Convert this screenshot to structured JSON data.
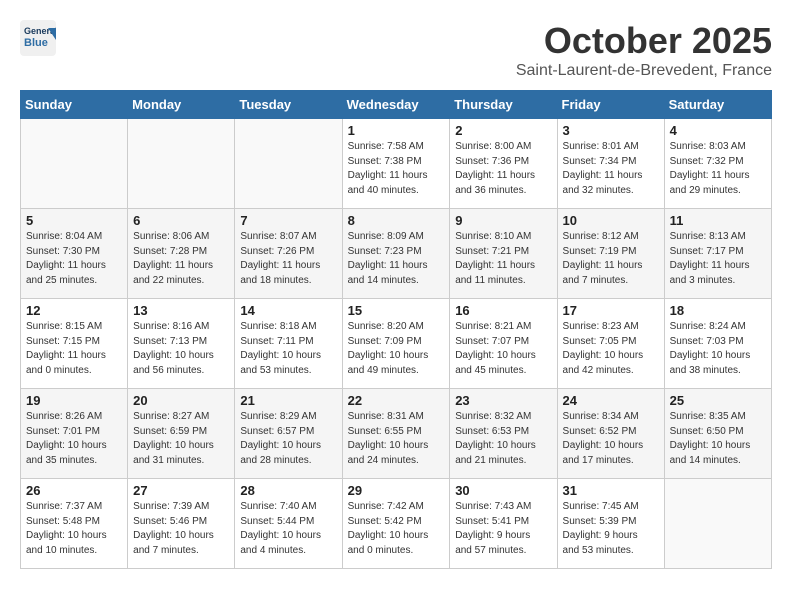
{
  "header": {
    "logo_line1": "General",
    "logo_line2": "Blue",
    "month": "October 2025",
    "location": "Saint-Laurent-de-Brevedent, France"
  },
  "weekdays": [
    "Sunday",
    "Monday",
    "Tuesday",
    "Wednesday",
    "Thursday",
    "Friday",
    "Saturday"
  ],
  "weeks": [
    [
      {
        "day": "",
        "info": ""
      },
      {
        "day": "",
        "info": ""
      },
      {
        "day": "",
        "info": ""
      },
      {
        "day": "1",
        "info": "Sunrise: 7:58 AM\nSunset: 7:38 PM\nDaylight: 11 hours\nand 40 minutes."
      },
      {
        "day": "2",
        "info": "Sunrise: 8:00 AM\nSunset: 7:36 PM\nDaylight: 11 hours\nand 36 minutes."
      },
      {
        "day": "3",
        "info": "Sunrise: 8:01 AM\nSunset: 7:34 PM\nDaylight: 11 hours\nand 32 minutes."
      },
      {
        "day": "4",
        "info": "Sunrise: 8:03 AM\nSunset: 7:32 PM\nDaylight: 11 hours\nand 29 minutes."
      }
    ],
    [
      {
        "day": "5",
        "info": "Sunrise: 8:04 AM\nSunset: 7:30 PM\nDaylight: 11 hours\nand 25 minutes."
      },
      {
        "day": "6",
        "info": "Sunrise: 8:06 AM\nSunset: 7:28 PM\nDaylight: 11 hours\nand 22 minutes."
      },
      {
        "day": "7",
        "info": "Sunrise: 8:07 AM\nSunset: 7:26 PM\nDaylight: 11 hours\nand 18 minutes."
      },
      {
        "day": "8",
        "info": "Sunrise: 8:09 AM\nSunset: 7:23 PM\nDaylight: 11 hours\nand 14 minutes."
      },
      {
        "day": "9",
        "info": "Sunrise: 8:10 AM\nSunset: 7:21 PM\nDaylight: 11 hours\nand 11 minutes."
      },
      {
        "day": "10",
        "info": "Sunrise: 8:12 AM\nSunset: 7:19 PM\nDaylight: 11 hours\nand 7 minutes."
      },
      {
        "day": "11",
        "info": "Sunrise: 8:13 AM\nSunset: 7:17 PM\nDaylight: 11 hours\nand 3 minutes."
      }
    ],
    [
      {
        "day": "12",
        "info": "Sunrise: 8:15 AM\nSunset: 7:15 PM\nDaylight: 11 hours\nand 0 minutes."
      },
      {
        "day": "13",
        "info": "Sunrise: 8:16 AM\nSunset: 7:13 PM\nDaylight: 10 hours\nand 56 minutes."
      },
      {
        "day": "14",
        "info": "Sunrise: 8:18 AM\nSunset: 7:11 PM\nDaylight: 10 hours\nand 53 minutes."
      },
      {
        "day": "15",
        "info": "Sunrise: 8:20 AM\nSunset: 7:09 PM\nDaylight: 10 hours\nand 49 minutes."
      },
      {
        "day": "16",
        "info": "Sunrise: 8:21 AM\nSunset: 7:07 PM\nDaylight: 10 hours\nand 45 minutes."
      },
      {
        "day": "17",
        "info": "Sunrise: 8:23 AM\nSunset: 7:05 PM\nDaylight: 10 hours\nand 42 minutes."
      },
      {
        "day": "18",
        "info": "Sunrise: 8:24 AM\nSunset: 7:03 PM\nDaylight: 10 hours\nand 38 minutes."
      }
    ],
    [
      {
        "day": "19",
        "info": "Sunrise: 8:26 AM\nSunset: 7:01 PM\nDaylight: 10 hours\nand 35 minutes."
      },
      {
        "day": "20",
        "info": "Sunrise: 8:27 AM\nSunset: 6:59 PM\nDaylight: 10 hours\nand 31 minutes."
      },
      {
        "day": "21",
        "info": "Sunrise: 8:29 AM\nSunset: 6:57 PM\nDaylight: 10 hours\nand 28 minutes."
      },
      {
        "day": "22",
        "info": "Sunrise: 8:31 AM\nSunset: 6:55 PM\nDaylight: 10 hours\nand 24 minutes."
      },
      {
        "day": "23",
        "info": "Sunrise: 8:32 AM\nSunset: 6:53 PM\nDaylight: 10 hours\nand 21 minutes."
      },
      {
        "day": "24",
        "info": "Sunrise: 8:34 AM\nSunset: 6:52 PM\nDaylight: 10 hours\nand 17 minutes."
      },
      {
        "day": "25",
        "info": "Sunrise: 8:35 AM\nSunset: 6:50 PM\nDaylight: 10 hours\nand 14 minutes."
      }
    ],
    [
      {
        "day": "26",
        "info": "Sunrise: 7:37 AM\nSunset: 5:48 PM\nDaylight: 10 hours\nand 10 minutes."
      },
      {
        "day": "27",
        "info": "Sunrise: 7:39 AM\nSunset: 5:46 PM\nDaylight: 10 hours\nand 7 minutes."
      },
      {
        "day": "28",
        "info": "Sunrise: 7:40 AM\nSunset: 5:44 PM\nDaylight: 10 hours\nand 4 minutes."
      },
      {
        "day": "29",
        "info": "Sunrise: 7:42 AM\nSunset: 5:42 PM\nDaylight: 10 hours\nand 0 minutes."
      },
      {
        "day": "30",
        "info": "Sunrise: 7:43 AM\nSunset: 5:41 PM\nDaylight: 9 hours\nand 57 minutes."
      },
      {
        "day": "31",
        "info": "Sunrise: 7:45 AM\nSunset: 5:39 PM\nDaylight: 9 hours\nand 53 minutes."
      },
      {
        "day": "",
        "info": ""
      }
    ]
  ]
}
